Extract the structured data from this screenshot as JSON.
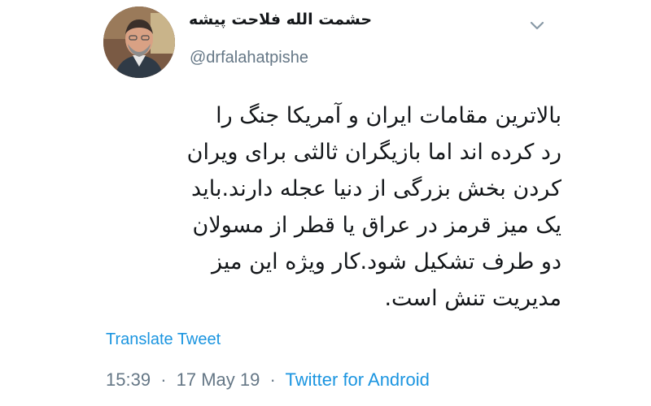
{
  "tweet": {
    "author": {
      "display_name": "حشمت الله فلاحت پیشه",
      "handle": "@drfalahatpishe"
    },
    "text_lines": [
      "بالاترین مقامات ایران و آمریکا جنگ را",
      "رد کرده اند اما بازیگران ثالثی برای ویران",
      "کردن بخش بزرگی از دنیا عجله دارند.باید",
      "یک میز قرمز در عراق یا قطر از مسولان",
      "دو طرف تشکیل شود.کار ویژه این میز",
      "مدیریت تنش است."
    ],
    "translate_label": "Translate Tweet",
    "time": "15:39",
    "date": "17 May 19",
    "separator": "·",
    "source": "Twitter for Android"
  },
  "icons": {
    "menu": "chevron-down-icon",
    "avatar": "avatar"
  },
  "colors": {
    "text": "#14171a",
    "secondary": "#657786",
    "link": "#1b95e0"
  }
}
